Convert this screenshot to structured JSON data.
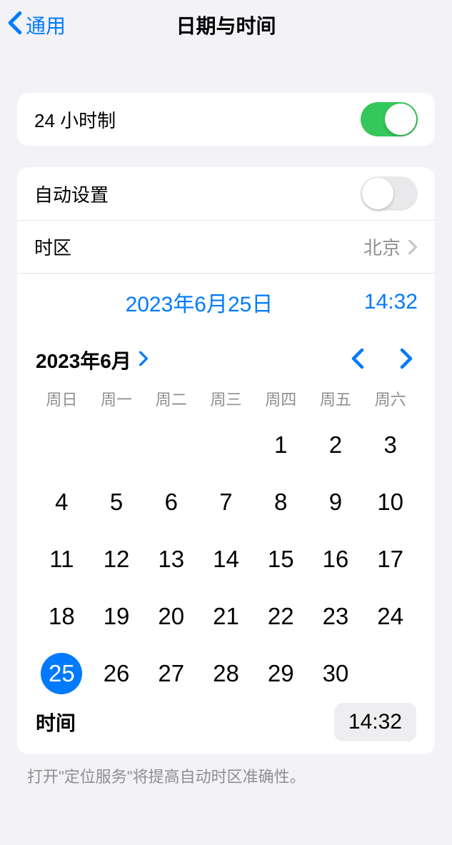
{
  "nav": {
    "back_label": "通用",
    "title": "日期与时间"
  },
  "hour24": {
    "label": "24 小时制",
    "on": true
  },
  "auto_set": {
    "label": "自动设置",
    "on": false
  },
  "timezone": {
    "label": "时区",
    "value": "北京"
  },
  "selected": {
    "date_display": "2023年6月25日",
    "time_display": "14:32"
  },
  "calendar": {
    "month_label": "2023年6月",
    "weekdays": [
      "周日",
      "周一",
      "周二",
      "周三",
      "周四",
      "周五",
      "周六"
    ],
    "first_weekday": 4,
    "days_in_month": 30,
    "selected_day": 25
  },
  "time_picker": {
    "label": "时间",
    "value": "14:32"
  },
  "footer": "打开\"定位服务\"将提高自动时区准确性。"
}
